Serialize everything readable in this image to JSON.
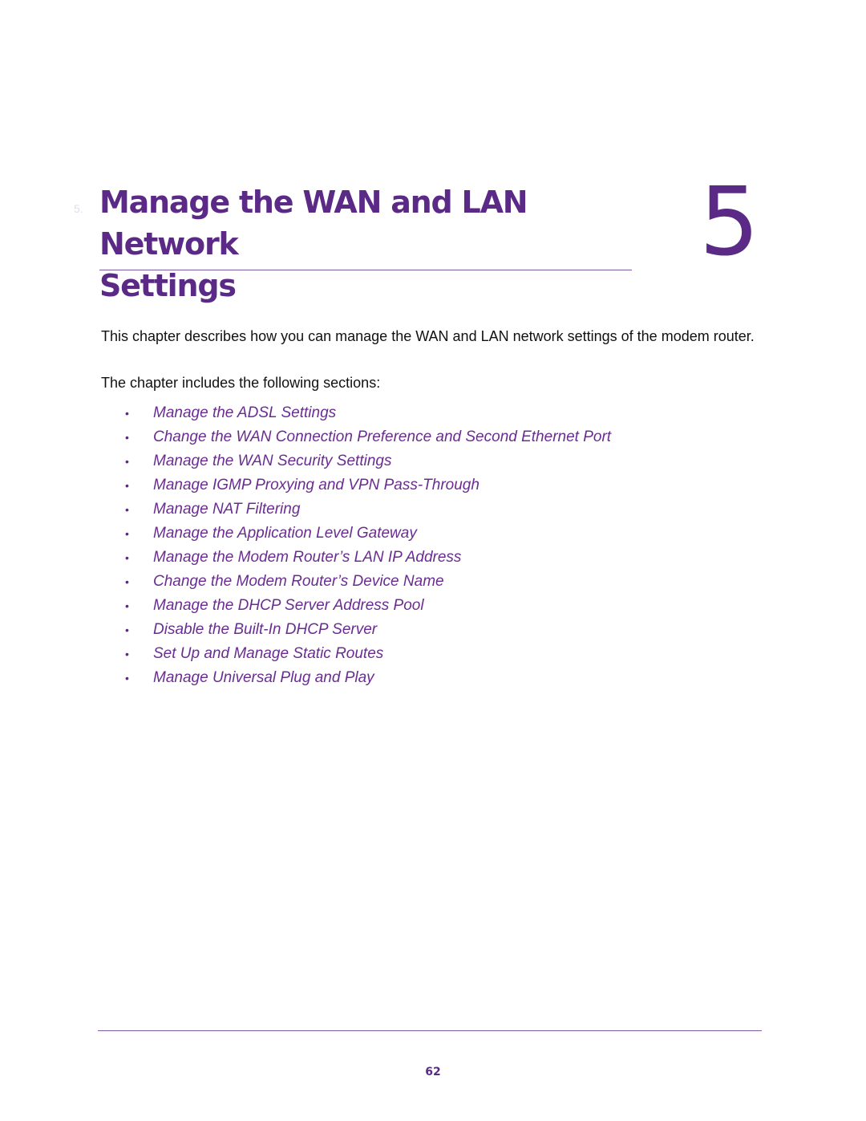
{
  "chapter": {
    "ghost_number": "5.",
    "title_line1": "Manage the WAN and LAN Network",
    "title_line2": "Settings",
    "number": "5"
  },
  "body": {
    "intro": "This chapter describes how you can manage the WAN and LAN network settings of the modem router.",
    "includes": "The chapter includes the following sections:"
  },
  "sections": [
    {
      "bullet": "•",
      "label": "Manage the ADSL Settings"
    },
    {
      "bullet": "•",
      "label": "Change the WAN Connection Preference and Second Ethernet Port"
    },
    {
      "bullet": "•",
      "label": "Manage the WAN Security Settings"
    },
    {
      "bullet": "•",
      "label": "Manage IGMP Proxying and VPN Pass-Through"
    },
    {
      "bullet": "•",
      "label": "Manage NAT Filtering"
    },
    {
      "bullet": "•",
      "label": "Manage the Application Level Gateway"
    },
    {
      "bullet": "•",
      "label": "Manage the Modem Router’s LAN IP Address"
    },
    {
      "bullet": "•",
      "label": "Change the Modem Router’s Device Name"
    },
    {
      "bullet": "•",
      "label": "Manage the DHCP Server Address Pool"
    },
    {
      "bullet": "•",
      "label": "Disable the Built-In DHCP Server"
    },
    {
      "bullet": "•",
      "label": "Set Up and Manage Static Routes"
    },
    {
      "bullet": "•",
      "label": "Manage Universal Plug and Play"
    }
  ],
  "footer": {
    "page_number": "62"
  },
  "colors": {
    "brand_purple": "#5b2a86",
    "link_purple": "#6a2c91",
    "rule_purple": "#7b5aa6"
  }
}
